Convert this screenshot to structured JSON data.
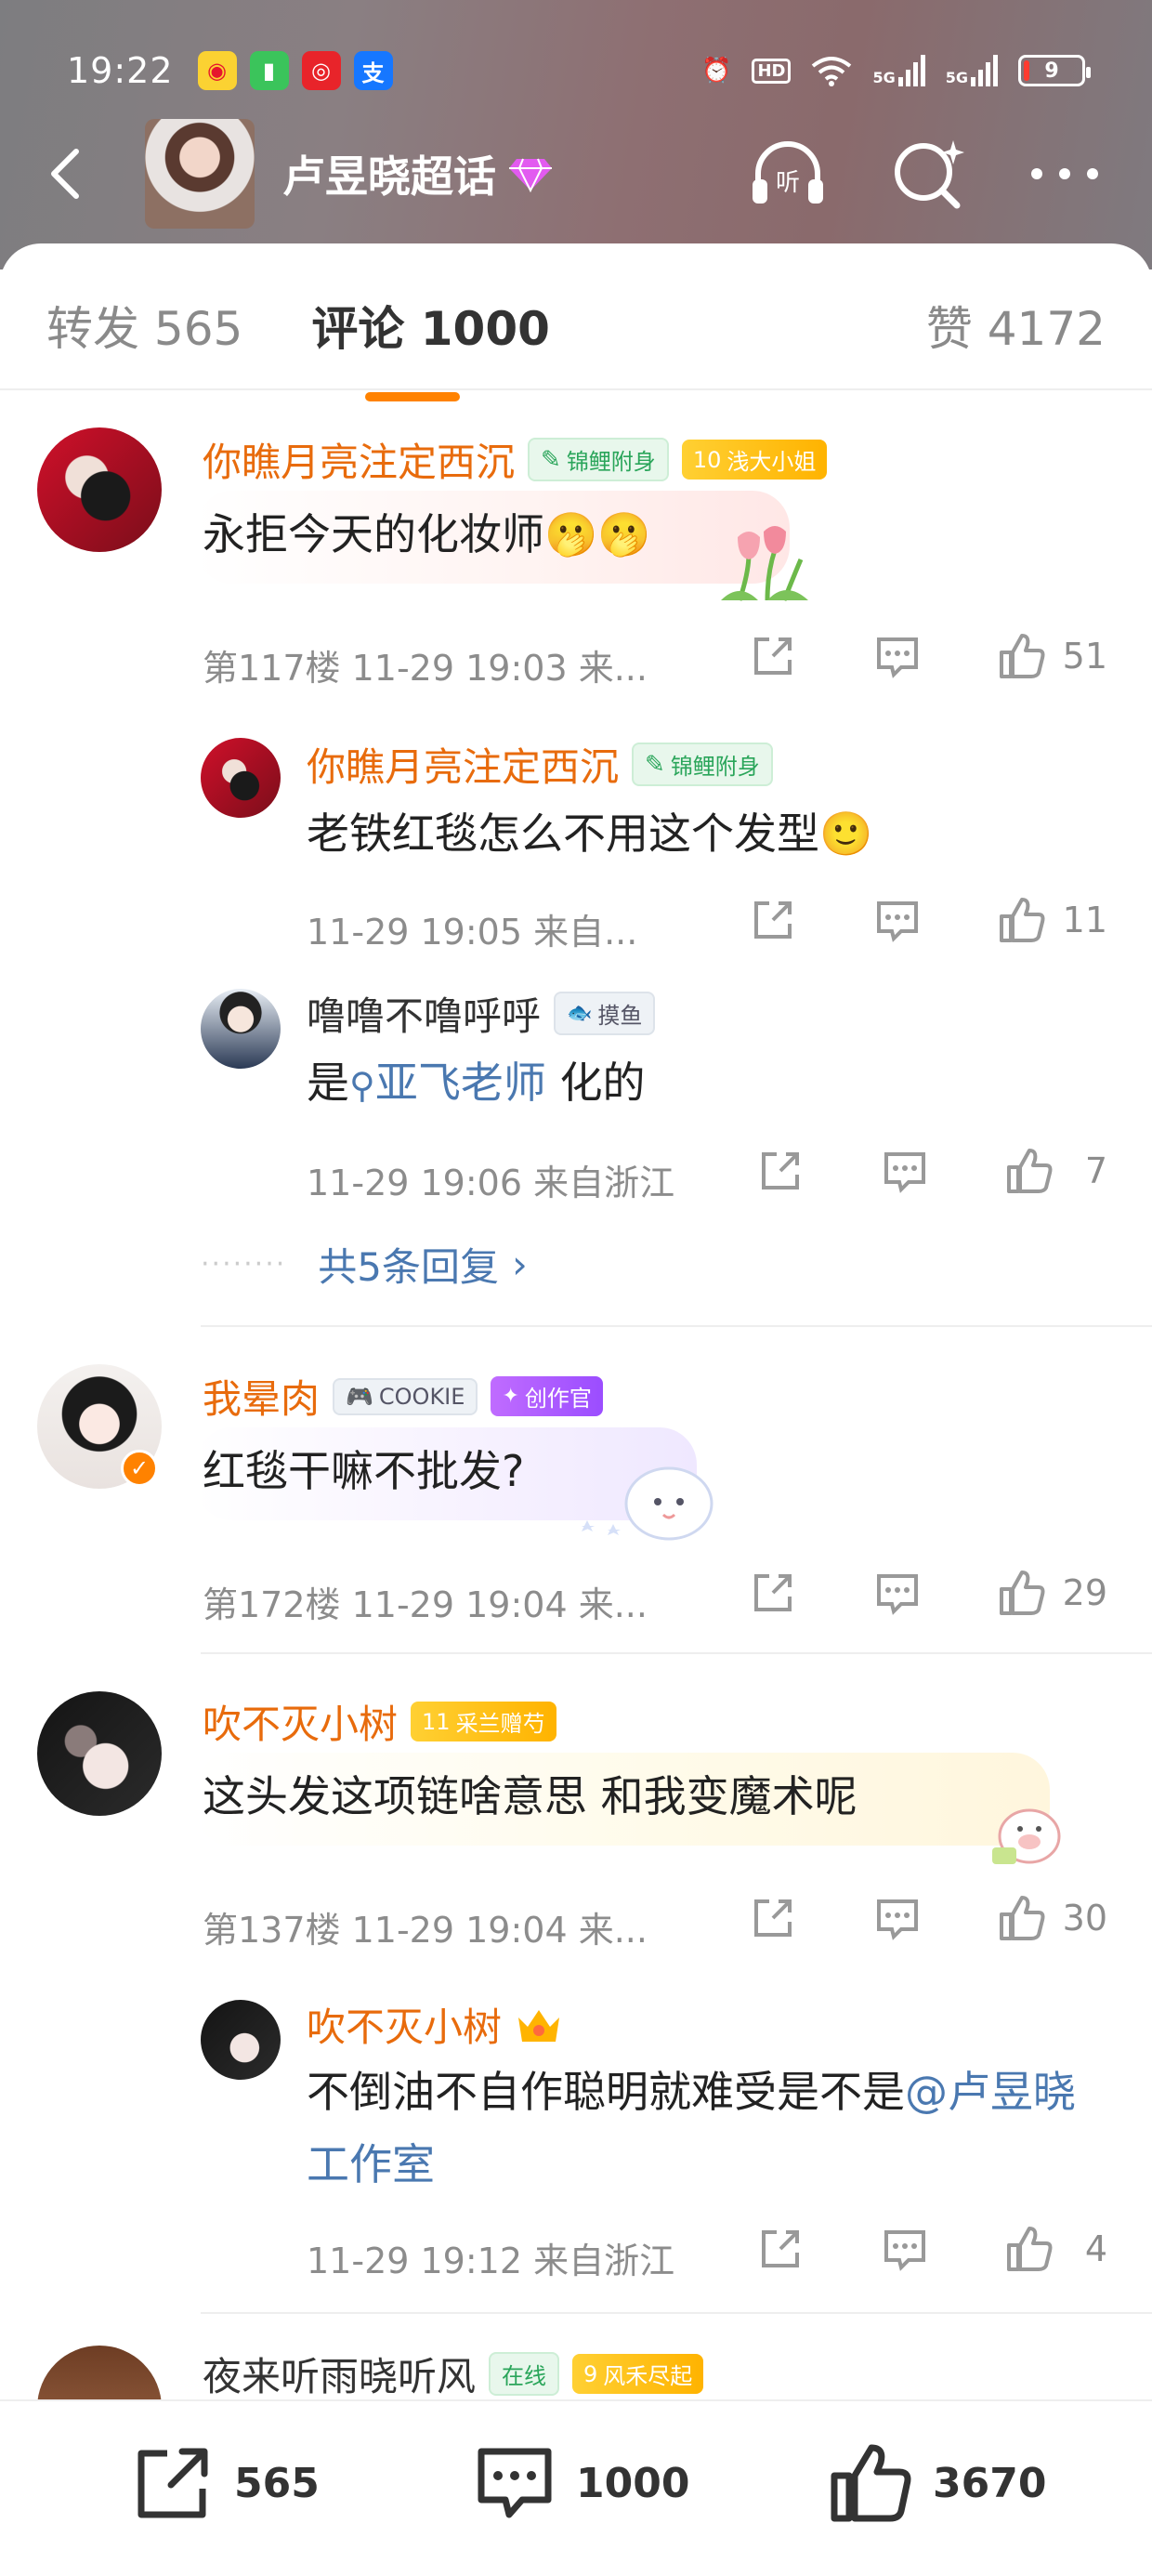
{
  "status": {
    "time": "19:22",
    "battery": "9",
    "network": "5G"
  },
  "topic": {
    "title": "卢昱晓超话"
  },
  "tabs": {
    "repost_label": "转发",
    "repost_count": "565",
    "comment_label": "评论",
    "comment_count": "1000",
    "likes_label": "赞",
    "likes_count": "4172"
  },
  "comments": [
    {
      "name": "你瞧月亮注定西沉",
      "badge1": "锦鲤附身",
      "badge2": "浅大小姐",
      "badge2_level": "10",
      "text": "永拒今天的化妆师🫢🫢",
      "meta": "第117楼 11-29 19:03 来...",
      "likes": "51",
      "replies": [
        {
          "name": "你瞧月亮注定西沉",
          "badge": "锦鲤附身",
          "text": "老铁红毯怎么不用这个发型🙂",
          "meta": "11-29 19:05 来自...",
          "likes": "11"
        },
        {
          "name": "噜噜不噜呼呼",
          "badge": "摸鱼",
          "text_pre": "是",
          "text_link": "亚飞老师",
          "text_post": " 化的",
          "meta": "11-29 19:06 来自浙江",
          "likes": "7"
        }
      ],
      "more_replies": "共5条回复"
    },
    {
      "name": "我晕肉",
      "badge1": "COOKIE",
      "badge2": "创作官",
      "text": "红毯干嘛不批发?",
      "meta": "第172楼 11-29 19:04 来...",
      "likes": "29"
    },
    {
      "name": "吹不灭小树",
      "badge1": "采兰赠芍",
      "badge1_level": "11",
      "text": "这头发这项链啥意思 和我变魔术呢",
      "meta": "第137楼 11-29 19:04 来...",
      "likes": "30",
      "replies": [
        {
          "name": "吹不灭小树",
          "text_main": "不倒油不自作聪明就难受是不是",
          "text_link": "@卢昱晓工作室",
          "meta": "11-29 19:12 来自浙江",
          "likes": "4"
        }
      ]
    },
    {
      "name": "夜来听雨晓听风",
      "badge1": "在线",
      "badge2": "风禾尽起",
      "badge2_level": "9"
    }
  ],
  "bottom": {
    "reposts": "565",
    "comments": "1000",
    "likes": "3670"
  },
  "colors": {
    "accent": "#ff8200",
    "nickname": "#e86b0c",
    "link": "#4a78b0",
    "meta": "#8c8c8c"
  }
}
